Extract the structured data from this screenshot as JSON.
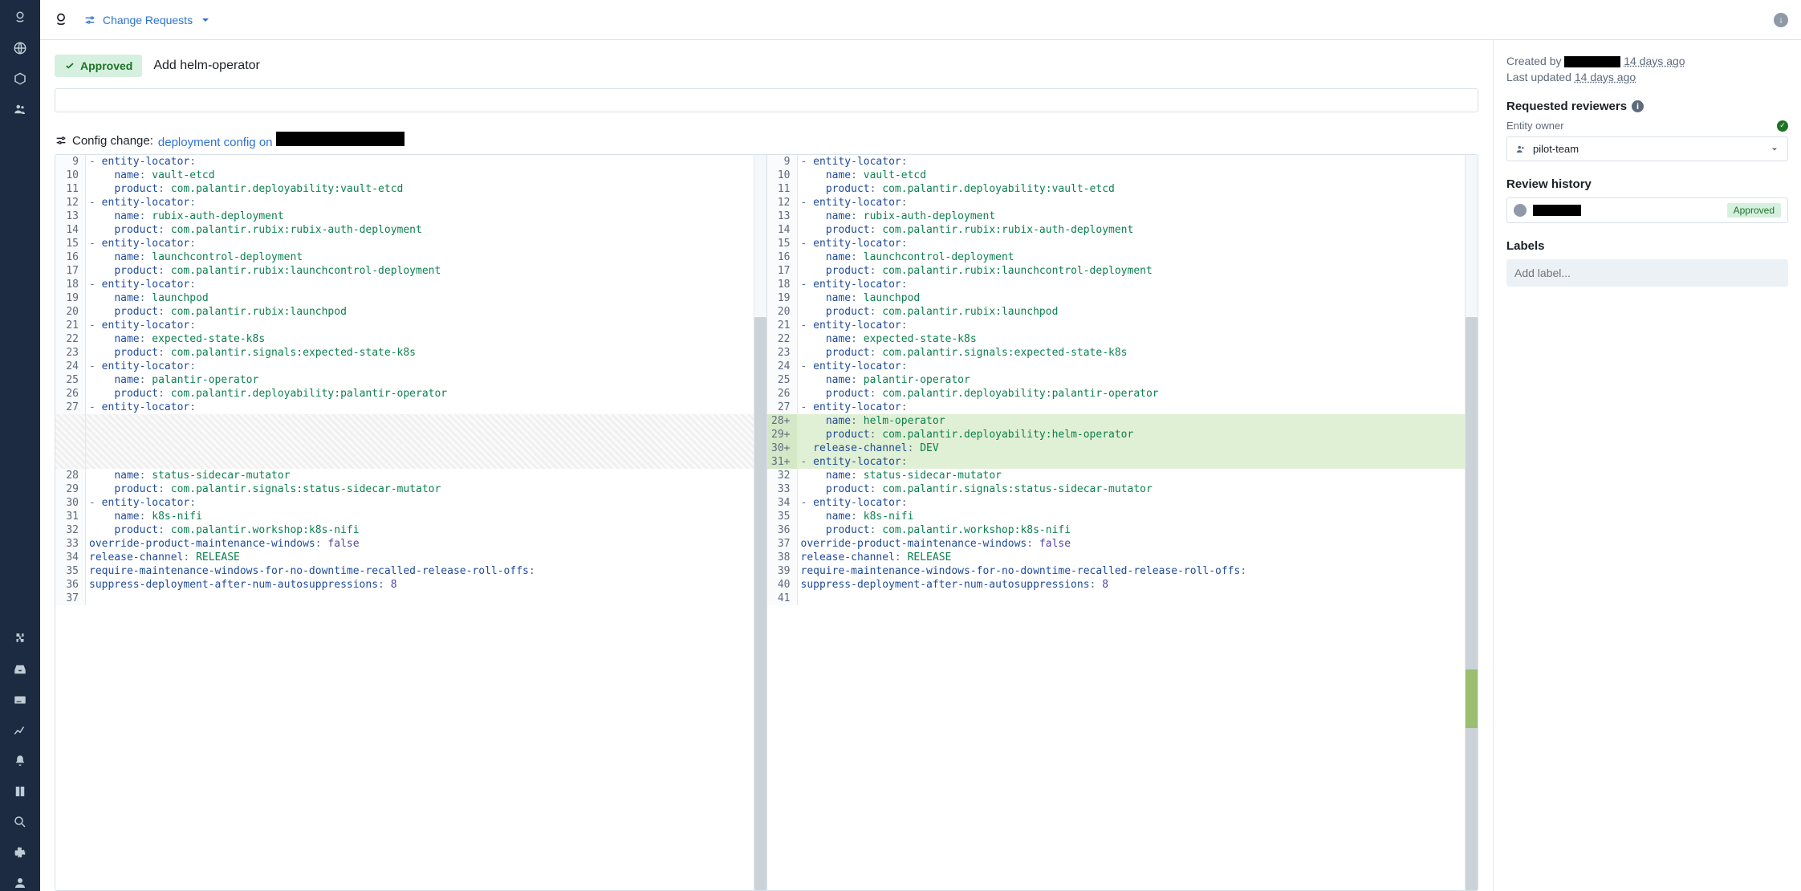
{
  "topbar": {
    "nav_label": "Change Requests"
  },
  "cr": {
    "status": "Approved",
    "title": "Add helm-operator"
  },
  "config_change": {
    "prefix": "Config change:",
    "link_text": "deployment config on "
  },
  "meta": {
    "created_by_label": "Created by",
    "created_ago": "14 days ago",
    "updated_label": "Last updated",
    "updated_ago": "14 days ago"
  },
  "reviewers": {
    "title": "Requested reviewers",
    "owner_label": "Entity owner",
    "owner_value": "pilot-team"
  },
  "review_history": {
    "title": "Review history",
    "status": "Approved"
  },
  "labels": {
    "title": "Labels",
    "placeholder": "Add label..."
  },
  "diff": {
    "left": [
      {
        "n": "9",
        "t": "- entity-locator:",
        "cls": ""
      },
      {
        "n": "10",
        "t": "    name: vault-etcd",
        "cls": ""
      },
      {
        "n": "11",
        "t": "    product: com.palantir.deployability:vault-etcd",
        "cls": ""
      },
      {
        "n": "12",
        "t": "- entity-locator:",
        "cls": ""
      },
      {
        "n": "13",
        "t": "    name: rubix-auth-deployment",
        "cls": ""
      },
      {
        "n": "14",
        "t": "    product: com.palantir.rubix:rubix-auth-deployment",
        "cls": ""
      },
      {
        "n": "15",
        "t": "- entity-locator:",
        "cls": ""
      },
      {
        "n": "16",
        "t": "    name: launchcontrol-deployment",
        "cls": ""
      },
      {
        "n": "17",
        "t": "    product: com.palantir.rubix:launchcontrol-deployment",
        "cls": ""
      },
      {
        "n": "18",
        "t": "- entity-locator:",
        "cls": ""
      },
      {
        "n": "19",
        "t": "    name: launchpod",
        "cls": ""
      },
      {
        "n": "20",
        "t": "    product: com.palantir.rubix:launchpod",
        "cls": ""
      },
      {
        "n": "21",
        "t": "- entity-locator:",
        "cls": ""
      },
      {
        "n": "22",
        "t": "    name: expected-state-k8s",
        "cls": ""
      },
      {
        "n": "23",
        "t": "    product: com.palantir.signals:expected-state-k8s",
        "cls": ""
      },
      {
        "n": "24",
        "t": "- entity-locator:",
        "cls": ""
      },
      {
        "n": "25",
        "t": "    name: palantir-operator",
        "cls": ""
      },
      {
        "n": "26",
        "t": "    product: com.palantir.deployability:palantir-operator",
        "cls": ""
      },
      {
        "n": "27",
        "t": "- entity-locator:",
        "cls": ""
      },
      {
        "n": "",
        "t": "",
        "cls": "empty"
      },
      {
        "n": "",
        "t": "",
        "cls": "empty"
      },
      {
        "n": "",
        "t": "",
        "cls": "empty"
      },
      {
        "n": "",
        "t": "",
        "cls": "empty"
      },
      {
        "n": "28",
        "t": "    name: status-sidecar-mutator",
        "cls": ""
      },
      {
        "n": "29",
        "t": "    product: com.palantir.signals:status-sidecar-mutator",
        "cls": ""
      },
      {
        "n": "30",
        "t": "- entity-locator:",
        "cls": ""
      },
      {
        "n": "31",
        "t": "    name: k8s-nifi",
        "cls": ""
      },
      {
        "n": "32",
        "t": "    product: com.palantir.workshop:k8s-nifi",
        "cls": ""
      },
      {
        "n": "33",
        "t": "override-product-maintenance-windows: false",
        "cls": ""
      },
      {
        "n": "34",
        "t": "release-channel: RELEASE",
        "cls": ""
      },
      {
        "n": "35",
        "t": "require-maintenance-windows-for-no-downtime-recalled-release-roll-offs:",
        "cls": ""
      },
      {
        "n": "36",
        "t": "suppress-deployment-after-num-autosuppressions: 8",
        "cls": ""
      },
      {
        "n": "37",
        "t": "",
        "cls": ""
      }
    ],
    "right": [
      {
        "n": "9",
        "t": "- entity-locator:",
        "cls": ""
      },
      {
        "n": "10",
        "t": "    name: vault-etcd",
        "cls": ""
      },
      {
        "n": "11",
        "t": "    product: com.palantir.deployability:vault-etcd",
        "cls": ""
      },
      {
        "n": "12",
        "t": "- entity-locator:",
        "cls": ""
      },
      {
        "n": "13",
        "t": "    name: rubix-auth-deployment",
        "cls": ""
      },
      {
        "n": "14",
        "t": "    product: com.palantir.rubix:rubix-auth-deployment",
        "cls": ""
      },
      {
        "n": "15",
        "t": "- entity-locator:",
        "cls": ""
      },
      {
        "n": "16",
        "t": "    name: launchcontrol-deployment",
        "cls": ""
      },
      {
        "n": "17",
        "t": "    product: com.palantir.rubix:launchcontrol-deployment",
        "cls": ""
      },
      {
        "n": "18",
        "t": "- entity-locator:",
        "cls": ""
      },
      {
        "n": "19",
        "t": "    name: launchpod",
        "cls": ""
      },
      {
        "n": "20",
        "t": "    product: com.palantir.rubix:launchpod",
        "cls": ""
      },
      {
        "n": "21",
        "t": "- entity-locator:",
        "cls": ""
      },
      {
        "n": "22",
        "t": "    name: expected-state-k8s",
        "cls": ""
      },
      {
        "n": "23",
        "t": "    product: com.palantir.signals:expected-state-k8s",
        "cls": ""
      },
      {
        "n": "24",
        "t": "- entity-locator:",
        "cls": ""
      },
      {
        "n": "25",
        "t": "    name: palantir-operator",
        "cls": ""
      },
      {
        "n": "26",
        "t": "    product: com.palantir.deployability:palantir-operator",
        "cls": ""
      },
      {
        "n": "27",
        "t": "- entity-locator:",
        "cls": ""
      },
      {
        "n": "28+",
        "t": "    name: helm-operator",
        "cls": "added"
      },
      {
        "n": "29+",
        "t": "    product: com.palantir.deployability:helm-operator",
        "cls": "added"
      },
      {
        "n": "30+",
        "t": "  release-channel: DEV",
        "cls": "added"
      },
      {
        "n": "31+",
        "t": "- entity-locator:",
        "cls": "added"
      },
      {
        "n": "32",
        "t": "    name: status-sidecar-mutator",
        "cls": ""
      },
      {
        "n": "33",
        "t": "    product: com.palantir.signals:status-sidecar-mutator",
        "cls": ""
      },
      {
        "n": "34",
        "t": "- entity-locator:",
        "cls": ""
      },
      {
        "n": "35",
        "t": "    name: k8s-nifi",
        "cls": ""
      },
      {
        "n": "36",
        "t": "    product: com.palantir.workshop:k8s-nifi",
        "cls": ""
      },
      {
        "n": "37",
        "t": "override-product-maintenance-windows: false",
        "cls": ""
      },
      {
        "n": "38",
        "t": "release-channel: RELEASE",
        "cls": ""
      },
      {
        "n": "39",
        "t": "require-maintenance-windows-for-no-downtime-recalled-release-roll-offs:",
        "cls": ""
      },
      {
        "n": "40",
        "t": "suppress-deployment-after-num-autosuppressions: 8",
        "cls": ""
      },
      {
        "n": "41",
        "t": "",
        "cls": ""
      }
    ]
  }
}
